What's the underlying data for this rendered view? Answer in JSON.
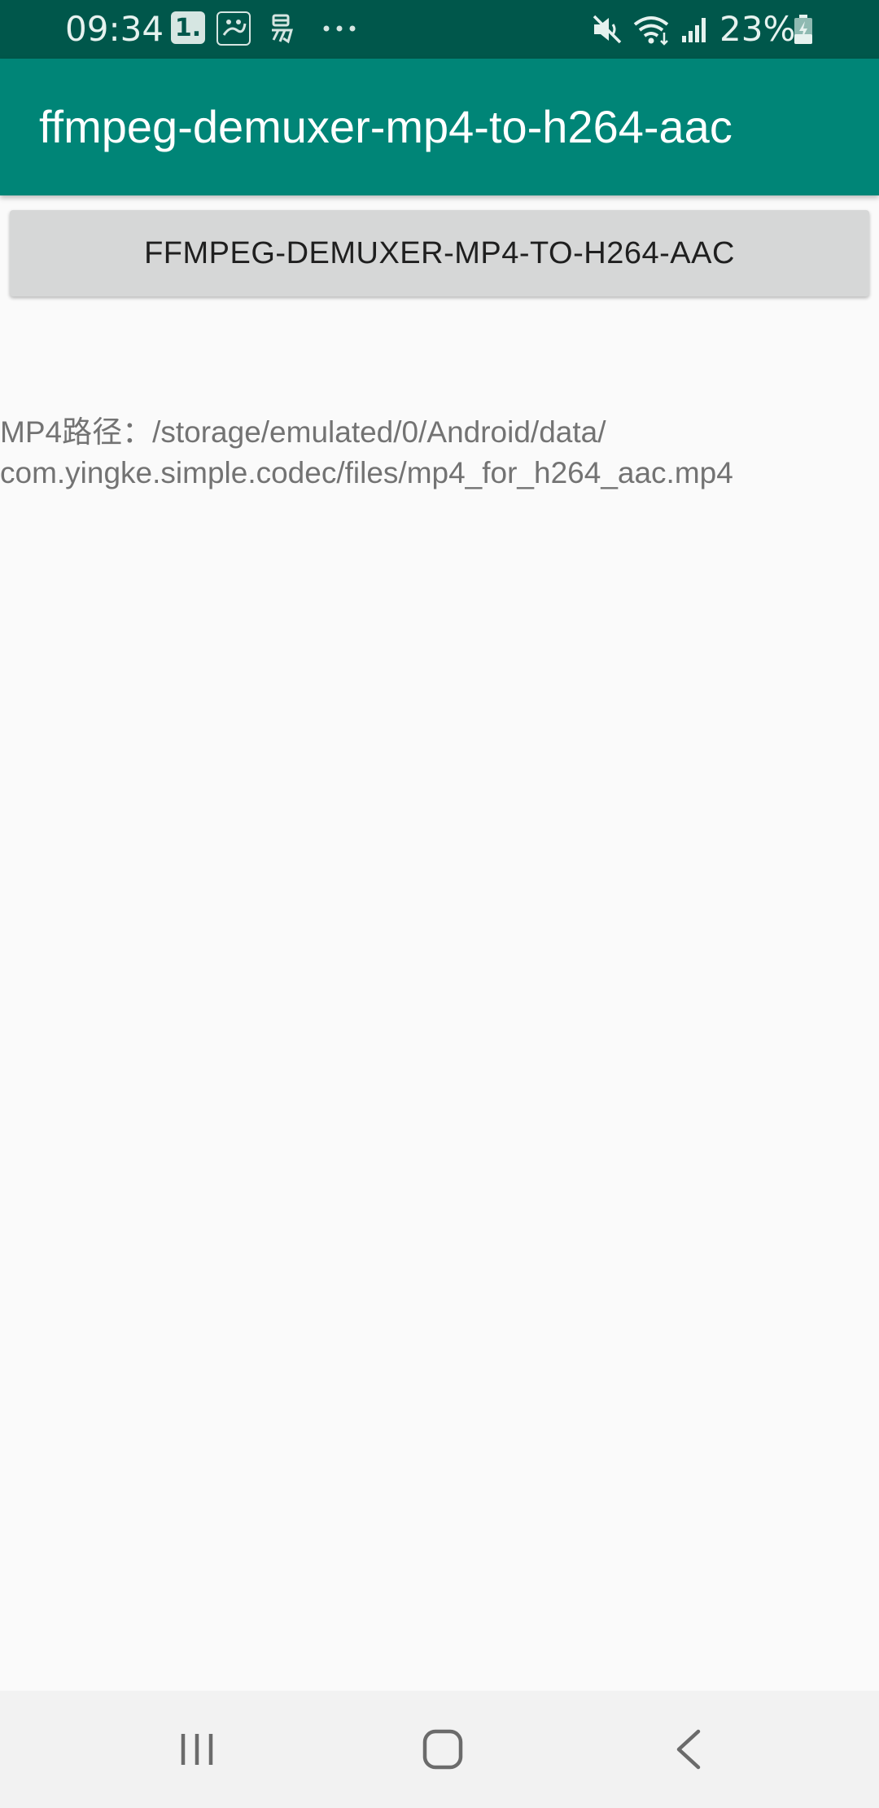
{
  "status_bar": {
    "time": "09:34",
    "notification_badge": "1.",
    "battery_percent": "23%",
    "icons": [
      "sohu-news-icon",
      "yi-app-icon",
      "more-notifications-icon",
      "mute-icon",
      "wifi-icon",
      "signal-icon",
      "battery-charging-icon"
    ]
  },
  "app_bar": {
    "title": "ffmpeg-demuxer-mp4-to-h264-aac",
    "color": "#008577"
  },
  "main": {
    "button_label": "FFMPEG-DEMUXER-MP4-TO-H264-AAC",
    "path_text": "MP4路径：/storage/emulated/0/Android/data/\ncom.yingke.simple.codec/files/mp4_for_h264_aac.mp4"
  },
  "nav_bar": {
    "icons": [
      "recent-apps-icon",
      "home-icon",
      "back-icon"
    ]
  },
  "colors": {
    "status_bar": "#00574b",
    "accent": "#008577",
    "button_bg": "#d6d7d7",
    "text_secondary": "#737373"
  }
}
